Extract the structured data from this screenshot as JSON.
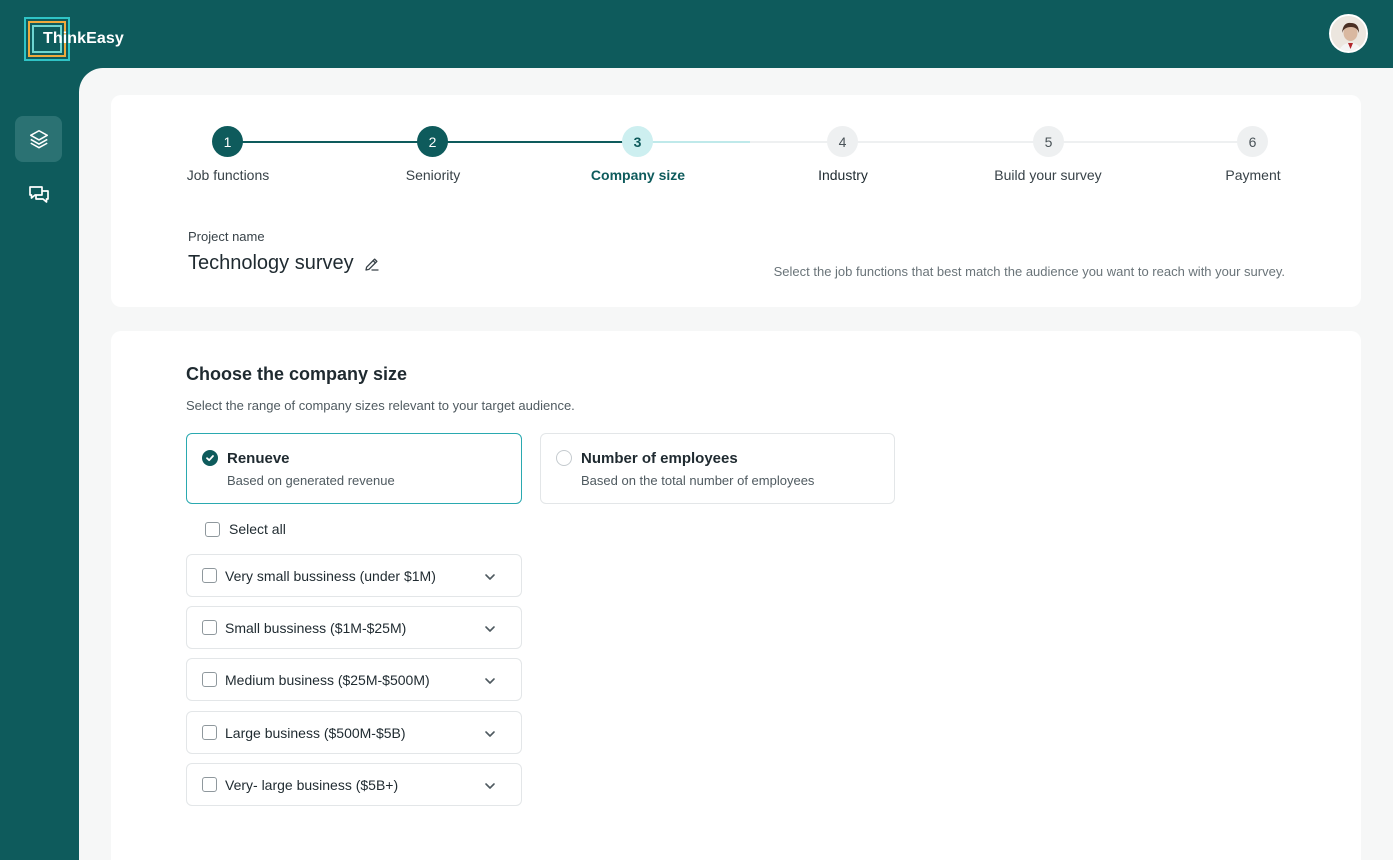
{
  "app": {
    "brand": "ThinkEasy"
  },
  "steps": [
    {
      "num": "1",
      "label": "Job functions",
      "state": "done"
    },
    {
      "num": "2",
      "label": "Seniority",
      "state": "done"
    },
    {
      "num": "3",
      "label": "Company size",
      "state": "current"
    },
    {
      "num": "4",
      "label": "Industry",
      "state": "todo"
    },
    {
      "num": "5",
      "label": "Build your survey",
      "state": "todo"
    },
    {
      "num": "6",
      "label": "Payment",
      "state": "todo"
    }
  ],
  "project": {
    "label": "Project name",
    "name": "Technology survey",
    "hint": "Select the job functions that best match the audience you want to reach with your survey."
  },
  "company_size": {
    "title": "Choose the company size",
    "subtitle": "Select the range of company sizes relevant to your target audience.",
    "options": [
      {
        "title": "Renueve",
        "desc": "Based on generated revenue",
        "selected": true
      },
      {
        "title": "Number of employees",
        "desc": "Based on the total number of employees",
        "selected": false
      }
    ],
    "select_all": "Select all",
    "ranges": [
      "Very small bussiness (under $1M)",
      "Small bussiness ($1M-$25M)",
      "Medium business ($25M-$500M)",
      "Large business ($500M-$5B)",
      "Very- large business ($5B+)"
    ]
  },
  "colors": {
    "brand": "#0e5b5c",
    "accent": "#2aa9b0",
    "current_step_bg": "#cdeff0"
  }
}
